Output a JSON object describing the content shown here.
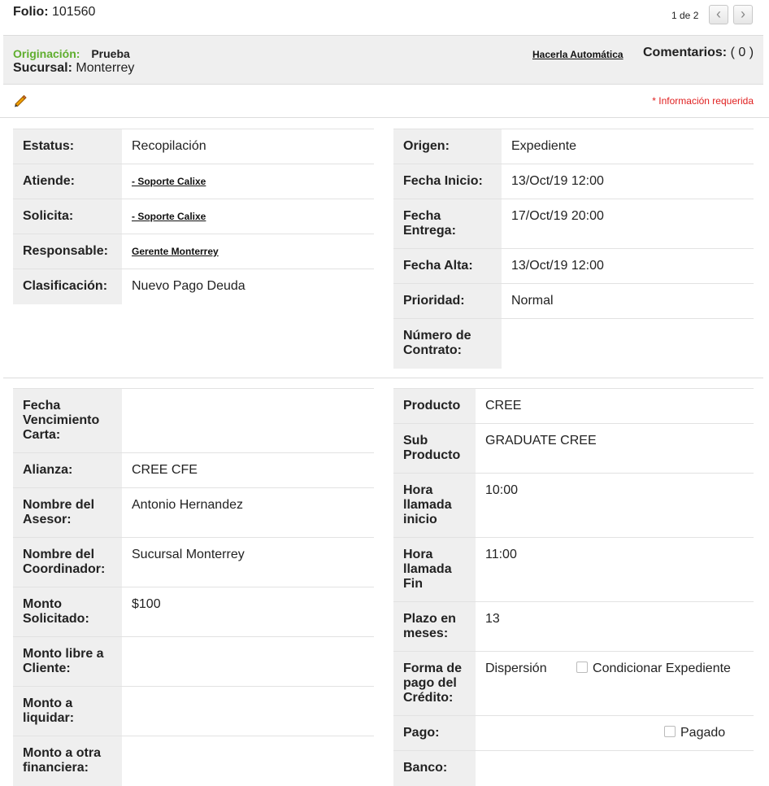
{
  "top": {
    "folio_label": "Folio:",
    "folio_value": "101560",
    "pager": "1 de 2",
    "prev_icon": "‹",
    "next_icon": "›"
  },
  "header": {
    "origination_label": "Originación:",
    "origination_value": "Prueba",
    "branch_label": "Sucursal:",
    "branch_value": "Monterrey",
    "make_automatic_link": "Hacerla Automática",
    "comments_label": "Comentarios:",
    "comments_value": "( 0 )"
  },
  "toolbar": {
    "edit_icon": "pencil-icon",
    "required_note": "* Información requerida"
  },
  "section1": {
    "left": [
      {
        "label": "Estatus:",
        "value": "Recopilación"
      },
      {
        "label": "Atiende:",
        "value": "- Soporte Calixe"
      },
      {
        "label": "Solicita:",
        "value": "- Soporte Calixe"
      },
      {
        "label": "Responsable:",
        "value": "Gerente Monterrey"
      },
      {
        "label": "Clasificación:",
        "value": "Nuevo Pago Deuda"
      }
    ],
    "right": [
      {
        "label": "Origen:",
        "value": "Expediente"
      },
      {
        "label": "Fecha Inicio:",
        "value": "13/Oct/19 12:00"
      },
      {
        "label": "Fecha Entrega:",
        "value": "17/Oct/19 20:00"
      },
      {
        "label": "Fecha Alta:",
        "value": "13/Oct/19 12:00"
      },
      {
        "label": "Prioridad:",
        "value": "Normal"
      },
      {
        "label": "Número de Contrato:",
        "value": ""
      }
    ]
  },
  "section2": {
    "left": [
      {
        "label": "Fecha Vencimiento Carta:",
        "value": ""
      },
      {
        "label": "Alianza:",
        "value": "CREE CFE"
      },
      {
        "label": "Nombre del Asesor:",
        "value": "Antonio Hernandez"
      },
      {
        "label": "Nombre del Coordinador:",
        "value": "Sucursal Monterrey"
      },
      {
        "label": "Monto Solicitado:",
        "value": "$100"
      },
      {
        "label": "Monto libre a Cliente:",
        "value": ""
      },
      {
        "label": "Monto a liquidar:",
        "value": ""
      },
      {
        "label": "Monto a otra financiera:",
        "value": ""
      }
    ],
    "right": [
      {
        "label": "Producto",
        "value": "CREE"
      },
      {
        "label": "Sub Producto",
        "value": "GRADUATE CREE"
      },
      {
        "label": "Hora llamada inicio",
        "value": "10:00"
      },
      {
        "label": "Hora llamada Fin",
        "value": "11:00"
      },
      {
        "label": "Plazo en meses:",
        "value": "13"
      },
      {
        "label": "Forma de pago del Crédito:",
        "value": "Dispersión",
        "checkbox_label": "Condicionar Expediente"
      },
      {
        "label": "Pago:",
        "value": "",
        "checkbox_label": "Pagado"
      },
      {
        "label": "Banco:",
        "value": ""
      }
    ]
  }
}
